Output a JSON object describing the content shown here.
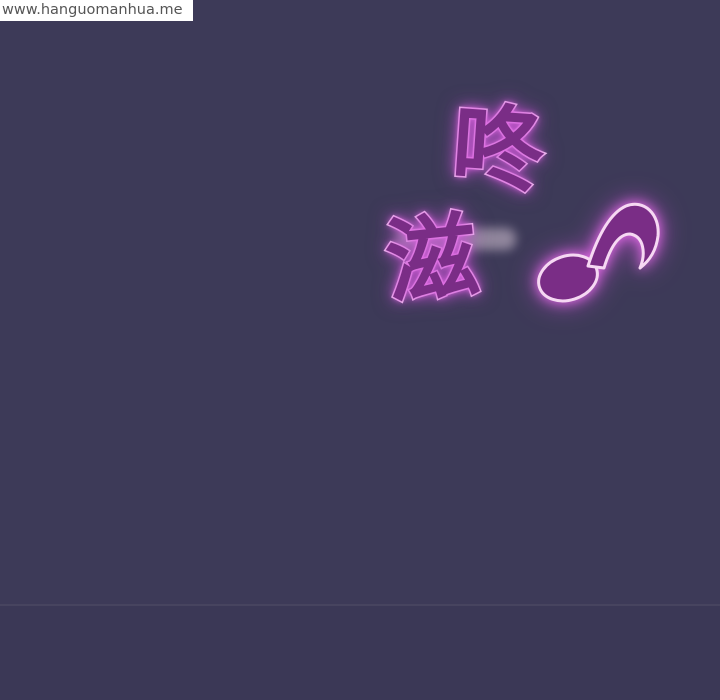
{
  "watermark": {
    "text": "www.hanguomanhua.me"
  },
  "sound_effect": {
    "line_1": "咚",
    "line_2": "滋",
    "note_icon": "music-note-icon"
  },
  "colors": {
    "background": "#3d3a58",
    "sfx_fill": "#7a2d86",
    "sfx_glow": "#e872e9",
    "sfx_outline": "#f6d8f3"
  }
}
